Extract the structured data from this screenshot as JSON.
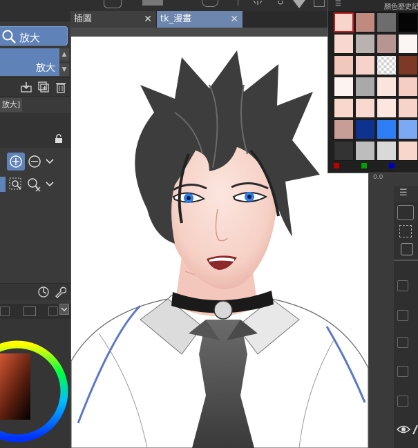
{
  "left_panel": {
    "zoom_tool_label": "放大",
    "subtool_label": "放大",
    "property_tab_label": "放大]",
    "icons": [
      "search-icon",
      "new-layer-icon",
      "duplicate-icon",
      "trash-icon",
      "lock-icon",
      "zoom-in-icon",
      "zoom-out-icon",
      "chevron-down-icon",
      "pointer-icon",
      "reset-icon",
      "settings-icon",
      "wrench-icon"
    ]
  },
  "tabs": [
    {
      "label": "插圖",
      "close": "✕",
      "active": false
    },
    {
      "label": "tk_漫畫",
      "close": "✕",
      "active": true
    }
  ],
  "color_history": {
    "title": "顏色歷史記",
    "menu_icon": "☰",
    "swatches": [
      [
        "#f6d6cc",
        "#c08a7e",
        "#6d6d6d",
        "#050505"
      ],
      [
        "#f7d7cf",
        "#b9b2b0",
        "#b79592",
        "#fbf5f3"
      ],
      [
        "#f2c8bc",
        "#f6d3ca",
        "transparent-checker",
        "#7e3826"
      ],
      [
        "#fdf4f1",
        "#a9a9a9",
        "#fbe4dd",
        "#f6cdc2"
      ],
      [
        "#f9d7cc",
        "#f8d9d0",
        "#fde6df",
        "#f7d3c8"
      ],
      [
        "#c79d96",
        "#0d3290",
        "#2e7ff5",
        "#7ba9f4"
      ],
      [
        "#333333",
        "#bdbdbd",
        "#d9d9d9",
        "#f9d6cc"
      ]
    ],
    "rgb_dots": [
      "#c00000",
      "#00a000",
      "#0000c0"
    ]
  },
  "right_panel": {
    "coords": "0.0",
    "menu_icon": "☰"
  },
  "colors": {
    "accent": "#5f82b8",
    "active_tab": "#6d86ad",
    "panel": "#3a3a3a"
  }
}
